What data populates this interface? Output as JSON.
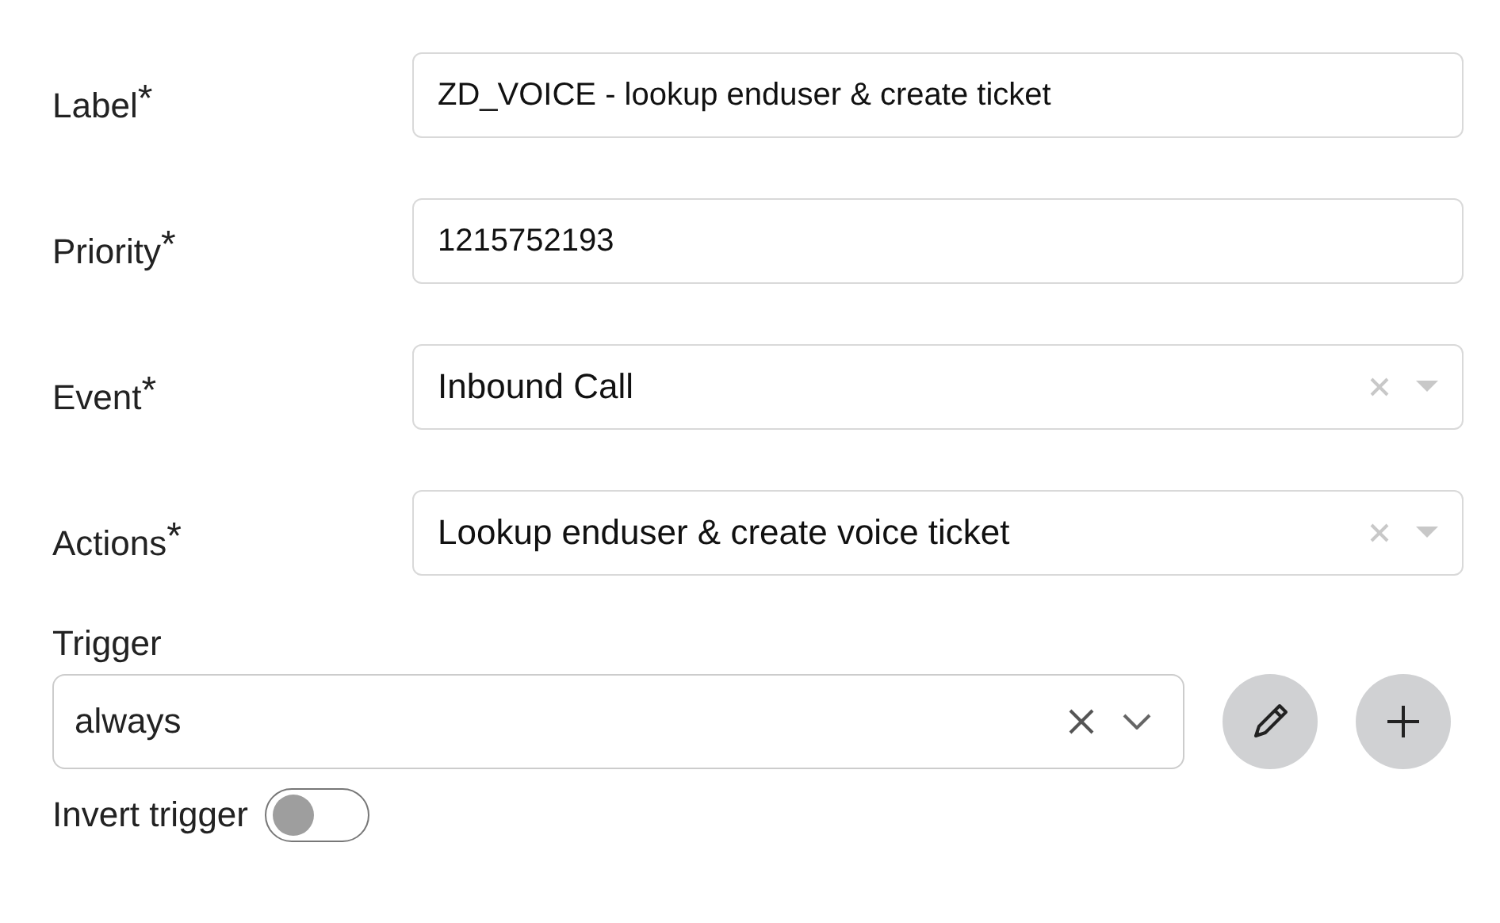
{
  "fields": [
    {
      "label": "Label$^{*}$",
      "kind": "text",
      "value": "ZD_VOICE - lookup enduser & create ticket"
    },
    {
      "label": "Priority$^{*}$",
      "kind": "text",
      "value": "1215752193"
    },
    {
      "label": "Event$^{*}$",
      "kind": "select",
      "value": "Inbound Call"
    },
    {
      "label": "Actions$^{*}$",
      "kind": "select",
      "value": "Lookup enduser & create voice ticket"
    }
  ],
  "trigger": {
    "label": "Trigger",
    "value": "always"
  },
  "invert_trigger": {
    "label": "Invert trigger",
    "on": false
  }
}
